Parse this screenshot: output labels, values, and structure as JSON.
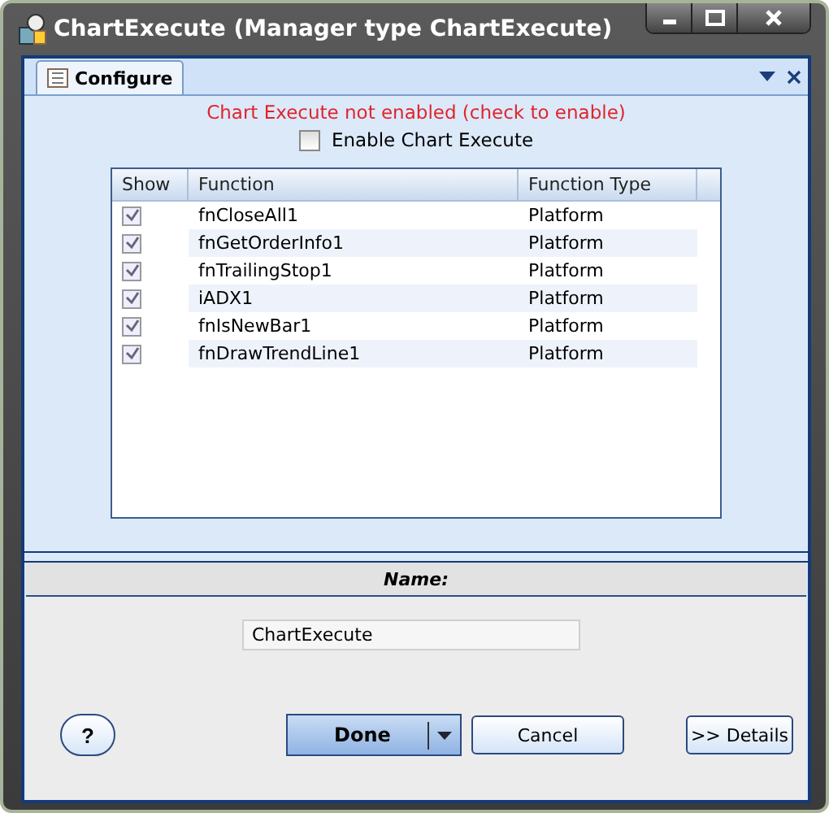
{
  "window": {
    "title": "ChartExecute (Manager type ChartExecute)"
  },
  "tabs": [
    {
      "label": "Configure",
      "selected": true
    }
  ],
  "warning": "Chart Execute not enabled (check to enable)",
  "enable": {
    "label": "Enable Chart Execute",
    "checked": false
  },
  "table": {
    "columns": [
      "Show",
      "Function",
      "Function Type"
    ],
    "rows": [
      {
        "show": true,
        "function": "fnCloseAll1",
        "type": "Platform"
      },
      {
        "show": true,
        "function": "fnGetOrderInfo1",
        "type": "Platform"
      },
      {
        "show": true,
        "function": "fnTrailingStop1",
        "type": "Platform"
      },
      {
        "show": true,
        "function": "iADX1",
        "type": "Platform"
      },
      {
        "show": true,
        "function": "fnIsNewBar1",
        "type": "Platform"
      },
      {
        "show": true,
        "function": "fnDrawTrendLine1",
        "type": "Platform"
      }
    ]
  },
  "name_section": {
    "heading": "Name:",
    "value": "ChartExecute"
  },
  "buttons": {
    "help": "?",
    "done": "Done",
    "cancel": "Cancel",
    "details": ">> Details"
  }
}
